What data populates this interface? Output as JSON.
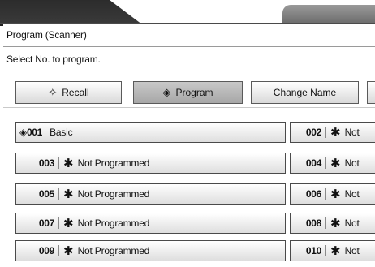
{
  "window": {
    "title": "Program (Scanner)",
    "instruction": "Select No. to program."
  },
  "toolbar": {
    "buttons": [
      {
        "label": "Recall",
        "icon": "recall-icon",
        "selected": false
      },
      {
        "label": "Program",
        "icon": "program-icon",
        "selected": true
      },
      {
        "label": "Change Name",
        "icon": "",
        "selected": false
      }
    ]
  },
  "programs": {
    "left": [
      {
        "num": "001",
        "name": "Basic",
        "programmed": true
      },
      {
        "num": "003",
        "name": "Not Programmed",
        "programmed": false
      },
      {
        "num": "005",
        "name": "Not Programmed",
        "programmed": false
      },
      {
        "num": "007",
        "name": "Not Programmed",
        "programmed": false
      },
      {
        "num": "009",
        "name": "Not Programmed",
        "programmed": false
      }
    ],
    "right": [
      {
        "num": "002",
        "name": "Not",
        "programmed": false
      },
      {
        "num": "004",
        "name": "Not",
        "programmed": false
      },
      {
        "num": "006",
        "name": "Not",
        "programmed": false
      },
      {
        "num": "008",
        "name": "Not",
        "programmed": false
      },
      {
        "num": "010",
        "name": "Not",
        "programmed": false
      }
    ]
  },
  "glyphs": {
    "star": "✱",
    "diamond": "◈",
    "recall": "✧"
  },
  "colors": {
    "tab_dark": "#2c2c2c",
    "selected_button": "#b3b3b3",
    "button_border": "#5a5a5a"
  }
}
